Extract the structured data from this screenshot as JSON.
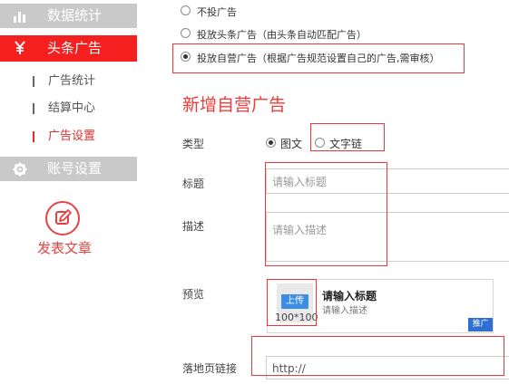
{
  "sidebar": {
    "menus": [
      {
        "label": "数据统计",
        "icon": "bar-chart-icon"
      },
      {
        "label": "头条广告",
        "icon": "yen-icon"
      },
      {
        "label": "账号设置",
        "icon": "gear-icon"
      }
    ],
    "sub_items": [
      {
        "label": "广告统计"
      },
      {
        "label": "结算中心"
      },
      {
        "label": "广告设置"
      }
    ],
    "write_button": {
      "label": "发表文章",
      "icon": "edit-icon"
    }
  },
  "ad_options": [
    {
      "label": "不投广告",
      "checked": false
    },
    {
      "label": "投放头条广告（由头条自动匹配广告）",
      "checked": false
    },
    {
      "label": "投放自营广告（根据广告规范设置自己的广告,需审核）",
      "checked": true
    }
  ],
  "form": {
    "title": "新增自营广告",
    "type_label": "类型",
    "type_options": [
      {
        "label": "图文",
        "checked": true
      },
      {
        "label": "文字链",
        "checked": false
      }
    ],
    "title_label": "标题",
    "title_placeholder": "请输入标题",
    "desc_label": "描述",
    "desc_placeholder": "请输入描述",
    "preview_label": "预览",
    "preview": {
      "upload_label": "上传",
      "size_label": "100*100",
      "title": "请输入标题",
      "desc": "请输入描述",
      "tag": "推广"
    },
    "link_label": "落地页链接",
    "link_value": "http://"
  },
  "colors": {
    "accent": "#f41f1f",
    "menu_gray": "#c9c9c9",
    "upload_blue": "#3d8ee0",
    "tag_blue": "#2f6fd1"
  }
}
